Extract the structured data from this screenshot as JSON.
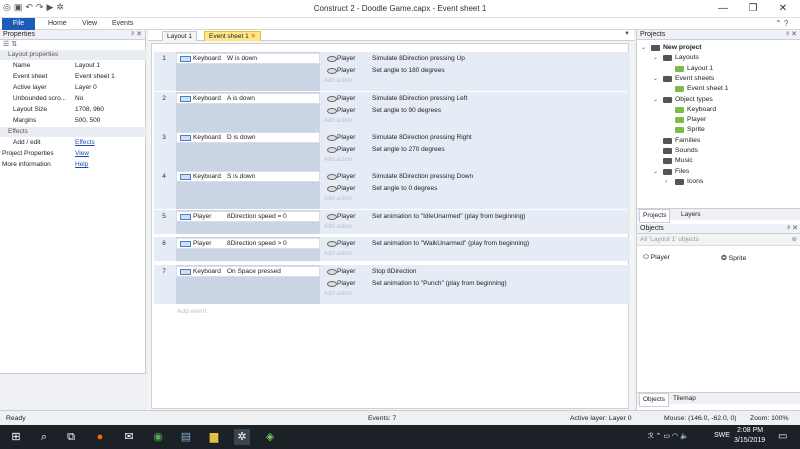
{
  "window": {
    "title": "Construct 2 - Doodle Game.capx - Event sheet 1",
    "minimize": "—",
    "maximize": "❐",
    "close": "✕"
  },
  "ribbon": {
    "tabs": [
      "File",
      "Home",
      "View",
      "Events"
    ]
  },
  "properties": {
    "header": "Properties",
    "rows": [
      {
        "k": "Layout properties",
        "sec": true
      },
      {
        "k": "Name",
        "v": "Layout 1"
      },
      {
        "k": "Event sheet",
        "v": "Event sheet 1"
      },
      {
        "k": "Active layer",
        "v": "Layer 0"
      },
      {
        "k": "Unbounded scro...",
        "v": "No"
      },
      {
        "k": "Layout Size",
        "v": "1708, 960"
      },
      {
        "k": "Margins",
        "v": "500, 500"
      },
      {
        "k": "Effects",
        "sec": true
      },
      {
        "k": "Add / edit",
        "v": "Effects",
        "link": true
      },
      {
        "k": "Project Properties",
        "v": "View",
        "link": true,
        "top": true
      },
      {
        "k": "More information",
        "v": "Help",
        "link": true,
        "top": true
      }
    ]
  },
  "doc_tabs": [
    "Layout 1",
    "Event sheet 1"
  ],
  "events": [
    {
      "n": "1",
      "obj": "Keyboard",
      "cond": "W is down",
      "actions": [
        {
          "o": "Player",
          "t": "Simulate 8Direction pressing Up"
        },
        {
          "o": "Player",
          "t": "Set angle to 180 degrees"
        }
      ]
    },
    {
      "n": "2",
      "obj": "Keyboard",
      "cond": "A is down",
      "actions": [
        {
          "o": "Player",
          "t": "Simulate 8Direction pressing Left"
        },
        {
          "o": "Player",
          "t": "Set angle to 90 degrees"
        }
      ]
    },
    {
      "n": "3",
      "obj": "Keyboard",
      "cond": "D is down",
      "actions": [
        {
          "o": "Player",
          "t": "Simulate 8Direction pressing Right"
        },
        {
          "o": "Player",
          "t": "Set angle to 270 degrees"
        }
      ]
    },
    {
      "n": "4",
      "obj": "Keyboard",
      "cond": "S is down",
      "actions": [
        {
          "o": "Player",
          "t": "Simulate 8Direction pressing Down"
        },
        {
          "o": "Player",
          "t": "Set angle to 0 degrees"
        }
      ]
    },
    {
      "n": "5",
      "obj": "Player",
      "cond": "8Direction speed = 0",
      "actions": [
        {
          "o": "Player",
          "t": "Set animation to \"IdleUnarmed\" (play from beginning)"
        }
      ]
    },
    {
      "n": "6",
      "obj": "Player",
      "cond": "8Direction speed > 0",
      "actions": [
        {
          "o": "Player",
          "t": "Set animation to \"WalkUnarmed\" (play from beginning)"
        }
      ]
    },
    {
      "n": "7",
      "obj": "Keyboard",
      "cond": "On Space pressed",
      "actions": [
        {
          "o": "Player",
          "t": "Stop 8Direction"
        },
        {
          "o": "Player",
          "t": "Set animation to \"Punch\" (play from beginning)"
        }
      ]
    }
  ],
  "add_action": "Add action",
  "add_event": "Add event",
  "projects": {
    "header": "Projects",
    "tree": [
      "New project",
      "Layouts",
      "Layout 1",
      "Event sheets",
      "Event sheet 1",
      "Object types",
      "Keyboard",
      "Player",
      "Sprite",
      "Families",
      "Sounds",
      "Music",
      "Files",
      "Icons"
    ],
    "tabs": [
      "Projects",
      "Layers"
    ]
  },
  "objects": {
    "header": "Objects",
    "filter": "All 'Layout 1' objects",
    "items": [
      "Player",
      "Sprite"
    ],
    "tabs": [
      "Objects",
      "Tilemap"
    ]
  },
  "status": {
    "ready": "Ready",
    "events": "Events: 7",
    "layer": "Active layer: Layer 0",
    "mouse": "Mouse: (146.0, -62.0, 0)",
    "zoom": "Zoom: 100%"
  },
  "tray": {
    "lang": "SWE",
    "time": "2:08 PM",
    "date": "3/15/2019"
  }
}
